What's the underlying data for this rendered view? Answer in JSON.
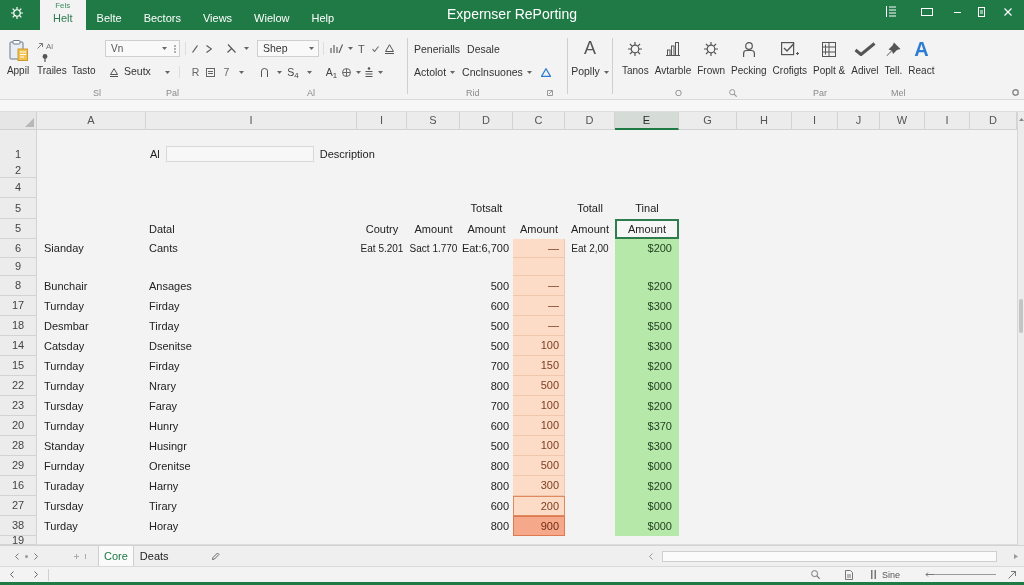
{
  "window": {
    "title": "Expernser RePorting"
  },
  "ribbon_tabs": [
    {
      "label": "Helt",
      "note": "Fels",
      "selected": true
    },
    {
      "label": "Belte",
      "selected": false
    },
    {
      "label": "Bectors",
      "selected": false
    },
    {
      "label": "Views",
      "selected": false
    },
    {
      "label": "Wielow",
      "selected": false
    },
    {
      "label": "Help",
      "selected": false
    }
  ],
  "ribbon": {
    "clipboard": {
      "paste": "Appil",
      "small_label": "Al",
      "buttons": [
        "Trailes",
        "Tasto"
      ]
    },
    "font": {
      "font_box": "Vn",
      "style_box": "Shep",
      "text_glyph": "T",
      "color_menu": "Seutx",
      "letters": [
        "R",
        "7"
      ],
      "script_menu": "S$_{4}$",
      "size_glyph": "A$_{1}$"
    },
    "paragraph": {
      "buttons": [
        "Penerialls",
        "Desale"
      ],
      "menus": [
        "Actolot",
        "Cnclnsuones"
      ]
    },
    "text": {
      "glyph": "A",
      "menu": "Poplly"
    },
    "commands": [
      {
        "label": "Tanos"
      },
      {
        "label": "Avtarble"
      },
      {
        "label": "Frown"
      },
      {
        "label": "Pecking"
      },
      {
        "label": "Crofigts"
      },
      {
        "label": "Poplt &"
      },
      {
        "label": "Adivel"
      },
      {
        "label": "Tell."
      },
      {
        "label": "React",
        "glyph": "A"
      }
    ],
    "captions": [
      "Sl",
      "Pal",
      "Al",
      "Rid",
      "O",
      "Par",
      "Mel"
    ]
  },
  "sheet": {
    "columns": [
      {
        "label": "A",
        "selected": false
      },
      {
        "label": "I",
        "selected": false
      },
      {
        "label": "I",
        "selected": false
      },
      {
        "label": "S",
        "selected": false
      },
      {
        "label": "D",
        "selected": false
      },
      {
        "label": "C",
        "selected": false
      },
      {
        "label": "D",
        "selected": false
      },
      {
        "label": "E",
        "selected": true
      },
      {
        "label": "G",
        "selected": false
      },
      {
        "label": "H",
        "selected": false
      },
      {
        "label": "I",
        "selected": false
      },
      {
        "label": "J",
        "selected": false
      },
      {
        "label": "W",
        "selected": false
      },
      {
        "label": "I",
        "selected": false
      },
      {
        "label": "D",
        "selected": false
      }
    ],
    "rows": [
      {
        "kind": "title",
        "header": "1",
        "label": "Al",
        "text": "Description"
      },
      {
        "kind": "spacer",
        "header": "2"
      },
      {
        "kind": "spacer",
        "header": "4"
      },
      {
        "kind": "heading",
        "header": "5",
        "cells": {
          "column_5": {
            "text": "Totsalt",
            "kind": "plain"
          },
          "column_7": {
            "text": "Totall",
            "kind": "plain"
          },
          "column_8": {
            "text": "Tinal",
            "kind": "plain"
          }
        }
      },
      {
        "kind": "heading",
        "header": "5",
        "cells": {
          "column_2": {
            "text": "Datal",
            "kind": "plain"
          },
          "column_3": {
            "text": "Coutry",
            "kind": "plain"
          },
          "column_4": {
            "text": "Amount",
            "kind": "plain"
          },
          "column_5": {
            "text": "Amount",
            "kind": "plain"
          },
          "column_6": {
            "text": "Amount",
            "kind": "plain"
          },
          "column_7": {
            "text": "Amount",
            "kind": "plain"
          },
          "column_8": {
            "text": "Amount",
            "kind": "selected"
          }
        }
      },
      {
        "kind": "data",
        "header": "6",
        "cells": {
          "column_1": {
            "text": "Sianday",
            "kind": "plain"
          },
          "column_2": {
            "text": "Cants",
            "kind": "plain"
          },
          "column_3": {
            "text": "Eat 5.201",
            "kind": "plain"
          },
          "column_4": {
            "text": "Sact 1.770",
            "kind": "plain"
          },
          "column_5": {
            "text": "Eat:6,700",
            "kind": "plain"
          },
          "column_6": {
            "text": "—",
            "kind": "warm"
          },
          "column_7": {
            "text": "Eat 2,00",
            "kind": "plain"
          },
          "column_8": {
            "text": "$200",
            "kind": "good"
          }
        }
      },
      {
        "kind": "data",
        "header": "9",
        "cells": {
          "column_6": {
            "kind": "warm"
          },
          "column_8": {
            "kind": "good"
          }
        }
      },
      {
        "kind": "data",
        "header": "8",
        "cells": {
          "column_1": {
            "text": "Bunchair",
            "kind": "plain"
          },
          "column_2": {
            "text": "Ansages",
            "kind": "plain"
          },
          "column_5": {
            "text": "500",
            "kind": "plain"
          },
          "column_6": {
            "text": "—",
            "kind": "warm"
          },
          "column_8": {
            "text": "$200",
            "kind": "good"
          }
        }
      },
      {
        "kind": "data",
        "header": "17",
        "cells": {
          "column_1": {
            "text": "Turnday",
            "kind": "plain"
          },
          "column_2": {
            "text": "Firday",
            "kind": "plain"
          },
          "column_5": {
            "text": "600",
            "kind": "plain"
          },
          "column_6": {
            "text": "—",
            "kind": "warm"
          },
          "column_8": {
            "text": "$300",
            "kind": "good"
          }
        }
      },
      {
        "kind": "data",
        "header": "18",
        "cells": {
          "column_1": {
            "text": "Desmbar",
            "kind": "plain"
          },
          "column_2": {
            "text": "Tirday",
            "kind": "plain"
          },
          "column_5": {
            "text": "500",
            "kind": "plain"
          },
          "column_6": {
            "text": "—",
            "kind": "warm"
          },
          "column_8": {
            "text": "$500",
            "kind": "good"
          }
        }
      },
      {
        "kind": "data",
        "header": "14",
        "cells": {
          "column_1": {
            "text": "Catsday",
            "kind": "plain"
          },
          "column_2": {
            "text": "Dsenitse",
            "kind": "plain"
          },
          "column_5": {
            "text": "500",
            "kind": "plain"
          },
          "column_6": {
            "text": "100",
            "kind": "warm"
          },
          "column_8": {
            "text": "$300",
            "kind": "good"
          }
        }
      },
      {
        "kind": "data",
        "header": "15",
        "cells": {
          "column_1": {
            "text": "Turnday",
            "kind": "plain"
          },
          "column_2": {
            "text": "Firday",
            "kind": "plain"
          },
          "column_5": {
            "text": "700",
            "kind": "plain"
          },
          "column_6": {
            "text": "150",
            "kind": "warm"
          },
          "column_8": {
            "text": "$200",
            "kind": "good"
          }
        }
      },
      {
        "kind": "data",
        "header": "22",
        "cells": {
          "column_1": {
            "text": "Turnday",
            "kind": "plain"
          },
          "column_2": {
            "text": "Nrary",
            "kind": "plain"
          },
          "column_5": {
            "text": "800",
            "kind": "plain"
          },
          "column_6": {
            "text": "500",
            "kind": "warm"
          },
          "column_8": {
            "text": "$000",
            "kind": "good"
          }
        }
      },
      {
        "kind": "data",
        "header": "23",
        "cells": {
          "column_1": {
            "text": "Tursday",
            "kind": "plain"
          },
          "column_2": {
            "text": "Faray",
            "kind": "plain"
          },
          "column_5": {
            "text": "700",
            "kind": "plain"
          },
          "column_6": {
            "text": "100",
            "kind": "warm"
          },
          "column_8": {
            "text": "$200",
            "kind": "good"
          }
        }
      },
      {
        "kind": "data",
        "header": "20",
        "cells": {
          "column_1": {
            "text": "Turnday",
            "kind": "plain"
          },
          "column_2": {
            "text": "Hunry",
            "kind": "plain"
          },
          "column_5": {
            "text": "600",
            "kind": "plain"
          },
          "column_6": {
            "text": "100",
            "kind": "warm"
          },
          "column_8": {
            "text": "$370",
            "kind": "good"
          }
        }
      },
      {
        "kind": "data",
        "header": "28",
        "cells": {
          "column_1": {
            "text": "Standay",
            "kind": "plain"
          },
          "column_2": {
            "text": "Husingr",
            "kind": "plain"
          },
          "column_5": {
            "text": "500",
            "kind": "plain"
          },
          "column_6": {
            "text": "100",
            "kind": "warm"
          },
          "column_8": {
            "text": "$300",
            "kind": "good"
          }
        }
      },
      {
        "kind": "data",
        "header": "29",
        "cells": {
          "column_1": {
            "text": "Furnday",
            "kind": "plain"
          },
          "column_2": {
            "text": "Orenitse",
            "kind": "plain"
          },
          "column_5": {
            "text": "800",
            "kind": "plain"
          },
          "column_6": {
            "text": "500",
            "kind": "warm"
          },
          "column_8": {
            "text": "$000",
            "kind": "good"
          }
        }
      },
      {
        "kind": "data",
        "header": "16",
        "cells": {
          "column_1": {
            "text": "Turaday",
            "kind": "plain"
          },
          "column_2": {
            "text": "Harny",
            "kind": "plain"
          },
          "column_5": {
            "text": "800",
            "kind": "plain"
          },
          "column_6": {
            "text": "300",
            "kind": "warm"
          },
          "column_8": {
            "text": "$200",
            "kind": "good"
          }
        }
      },
      {
        "kind": "data",
        "header": "27",
        "cells": {
          "column_1": {
            "text": "Tursday",
            "kind": "plain"
          },
          "column_2": {
            "text": "Tirary",
            "kind": "plain"
          },
          "column_5": {
            "text": "600",
            "kind": "plain"
          },
          "column_6": {
            "text": "200",
            "kind": "warm_outlined"
          },
          "column_8": {
            "text": "$000",
            "kind": "good"
          }
        }
      },
      {
        "kind": "data",
        "header": "38",
        "cells": {
          "column_1": {
            "text": "Turday",
            "kind": "plain"
          },
          "column_2": {
            "text": "Horay",
            "kind": "plain"
          },
          "column_5": {
            "text": "800",
            "kind": "plain"
          },
          "column_6": {
            "text": "900",
            "kind": "warm_strong"
          },
          "column_8": {
            "text": "$000",
            "kind": "good"
          }
        }
      },
      {
        "kind": "data",
        "header": "19"
      }
    ]
  },
  "sheet_tabs": [
    {
      "label": "Core",
      "selected": true
    },
    {
      "label": "Deats",
      "selected": false
    }
  ],
  "status_bar": {
    "label": "Sine"
  }
}
